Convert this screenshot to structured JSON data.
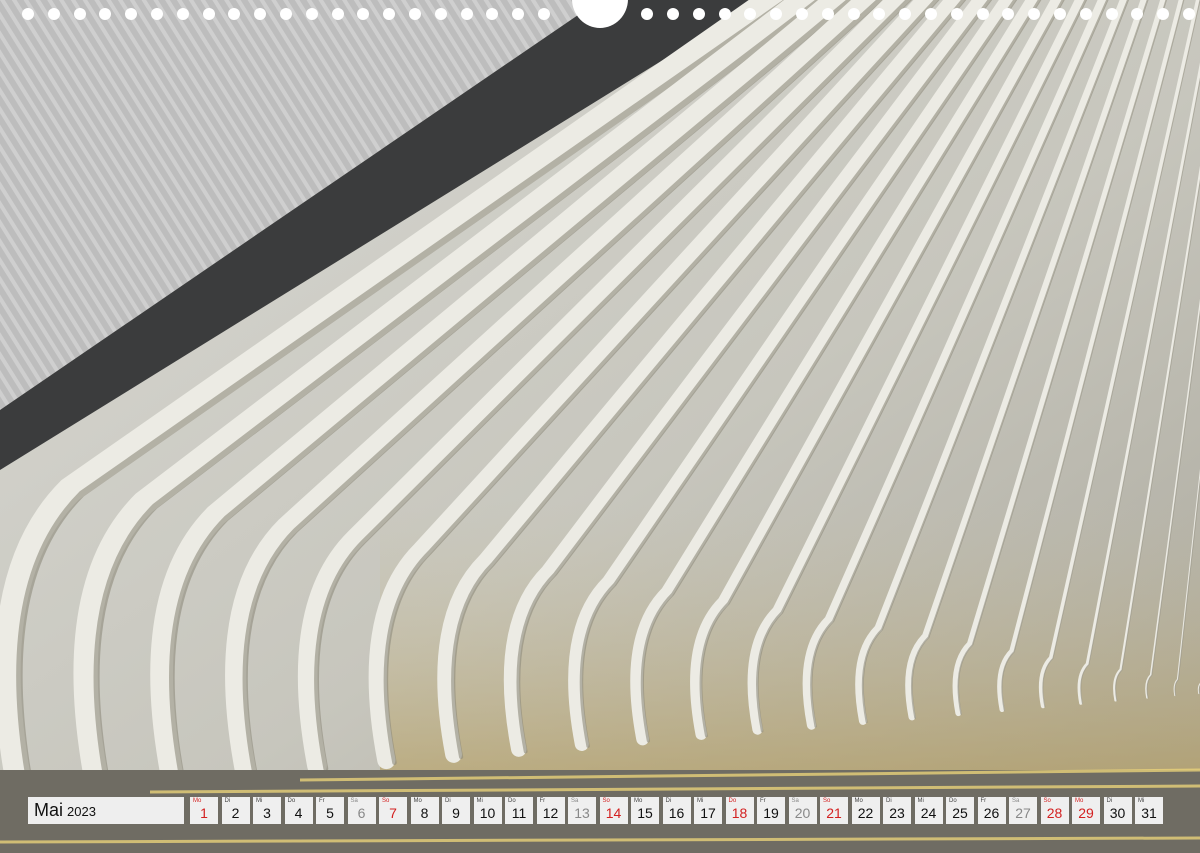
{
  "calendar": {
    "month": "Mai",
    "year": "2023",
    "days": [
      {
        "wd": "Mo",
        "d": "1",
        "kind": "red"
      },
      {
        "wd": "Di",
        "d": "2",
        "kind": "normal"
      },
      {
        "wd": "Mi",
        "d": "3",
        "kind": "normal"
      },
      {
        "wd": "Do",
        "d": "4",
        "kind": "normal"
      },
      {
        "wd": "Fr",
        "d": "5",
        "kind": "normal"
      },
      {
        "wd": "Sa",
        "d": "6",
        "kind": "sat"
      },
      {
        "wd": "So",
        "d": "7",
        "kind": "red"
      },
      {
        "wd": "Mo",
        "d": "8",
        "kind": "normal"
      },
      {
        "wd": "Di",
        "d": "9",
        "kind": "normal"
      },
      {
        "wd": "Mi",
        "d": "10",
        "kind": "normal"
      },
      {
        "wd": "Do",
        "d": "11",
        "kind": "normal"
      },
      {
        "wd": "Fr",
        "d": "12",
        "kind": "normal"
      },
      {
        "wd": "Sa",
        "d": "13",
        "kind": "sat"
      },
      {
        "wd": "So",
        "d": "14",
        "kind": "red"
      },
      {
        "wd": "Mo",
        "d": "15",
        "kind": "normal"
      },
      {
        "wd": "Di",
        "d": "16",
        "kind": "normal"
      },
      {
        "wd": "Mi",
        "d": "17",
        "kind": "normal"
      },
      {
        "wd": "Do",
        "d": "18",
        "kind": "red"
      },
      {
        "wd": "Fr",
        "d": "19",
        "kind": "normal"
      },
      {
        "wd": "Sa",
        "d": "20",
        "kind": "sat"
      },
      {
        "wd": "So",
        "d": "21",
        "kind": "red"
      },
      {
        "wd": "Mo",
        "d": "22",
        "kind": "normal"
      },
      {
        "wd": "Di",
        "d": "23",
        "kind": "normal"
      },
      {
        "wd": "Mi",
        "d": "24",
        "kind": "normal"
      },
      {
        "wd": "Do",
        "d": "25",
        "kind": "normal"
      },
      {
        "wd": "Fr",
        "d": "26",
        "kind": "normal"
      },
      {
        "wd": "Sa",
        "d": "27",
        "kind": "sat"
      },
      {
        "wd": "So",
        "d": "28",
        "kind": "red"
      },
      {
        "wd": "Mo",
        "d": "29",
        "kind": "red"
      },
      {
        "wd": "Di",
        "d": "30",
        "kind": "normal"
      },
      {
        "wd": "Mi",
        "d": "31",
        "kind": "normal"
      }
    ]
  },
  "colors": {
    "holiday": "#d32020",
    "saturday": "#888888",
    "cell": "#efefef"
  }
}
